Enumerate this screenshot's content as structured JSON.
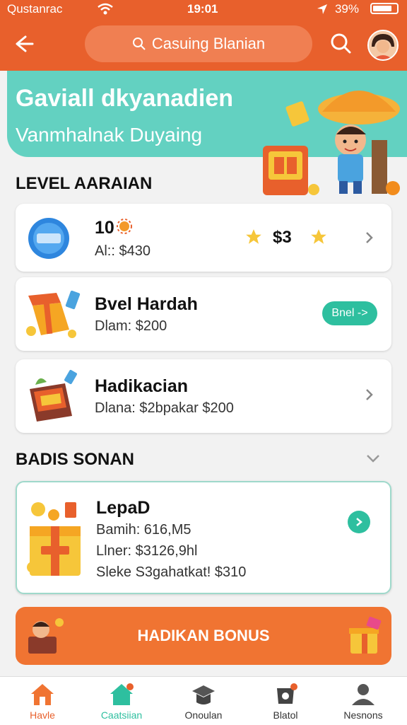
{
  "status_bar": {
    "carrier": "Qustanrac",
    "time": "19:01",
    "battery": "39%"
  },
  "header": {
    "search_text": "Casuing Blanian"
  },
  "banner": {
    "title": "Gaviall dkyanadien",
    "subtitle": "Vanmhalnak Duyaing"
  },
  "level_section": {
    "title": "LEVEL AARAIAN",
    "cards": [
      {
        "title": "10",
        "sub": "Al:: $430",
        "score": "$3"
      },
      {
        "title": "Bvel Hardah",
        "sub": "Dlam: $200",
        "pill": "Bnel ->"
      },
      {
        "title": "Hadikacian",
        "sub": "Dlana: $2bpakar $200"
      }
    ]
  },
  "bonus_section": {
    "title": "BADIS SONAN",
    "card": {
      "title": "LepaD",
      "lines": [
        "Bamih: 616,M5",
        "Llner: $3126,9hl",
        "Sleke S3gahatkat! $310"
      ]
    },
    "button_label": "HADIKAN BONUS"
  },
  "bottom_nav": [
    {
      "label": "Havle",
      "color": "#e8602c"
    },
    {
      "label": "Caatsiian",
      "color": "#2ebf9f"
    },
    {
      "label": "Onoulan",
      "color": "#333333"
    },
    {
      "label": "Blatol",
      "color": "#333333"
    },
    {
      "label": "Nesnons",
      "color": "#333333"
    }
  ]
}
